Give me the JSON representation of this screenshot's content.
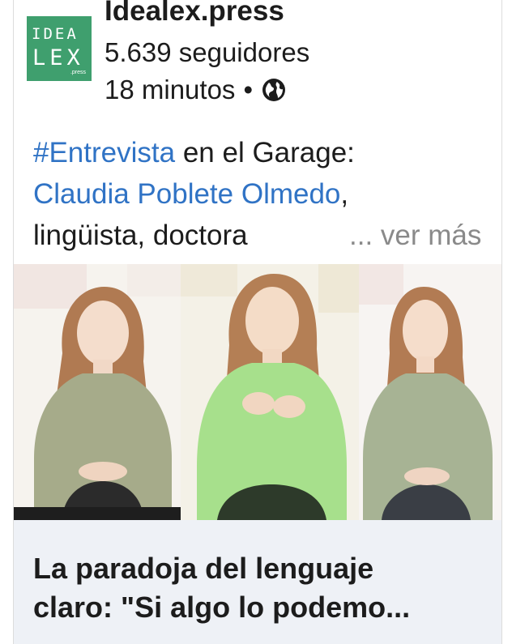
{
  "post": {
    "page_name": "Idealex.press",
    "followers": "5.639 seguidores",
    "time": "18 minutos",
    "separator": "•",
    "visibility_icon": "globe-icon",
    "logo": {
      "line1": "IDEA",
      "line2": "LEX",
      "line3": ".press",
      "color": "#3f9f6e"
    },
    "text": {
      "hashtag": "#Entrevista",
      "line1_rest": " en el Garage:",
      "mention": "Claudia Poblete Olmedo",
      "line2_rest": ",",
      "line3": "lingüista, doctora",
      "see_more": "... ver más"
    },
    "link_preview": {
      "title_line1": "La paradoja del lenguaje",
      "title_line2": "claro: \"Si algo lo podemo..."
    },
    "colors": {
      "link": "#3073c5",
      "muted": "#8a8a8a",
      "preview_bg": "#eef1f6"
    }
  }
}
